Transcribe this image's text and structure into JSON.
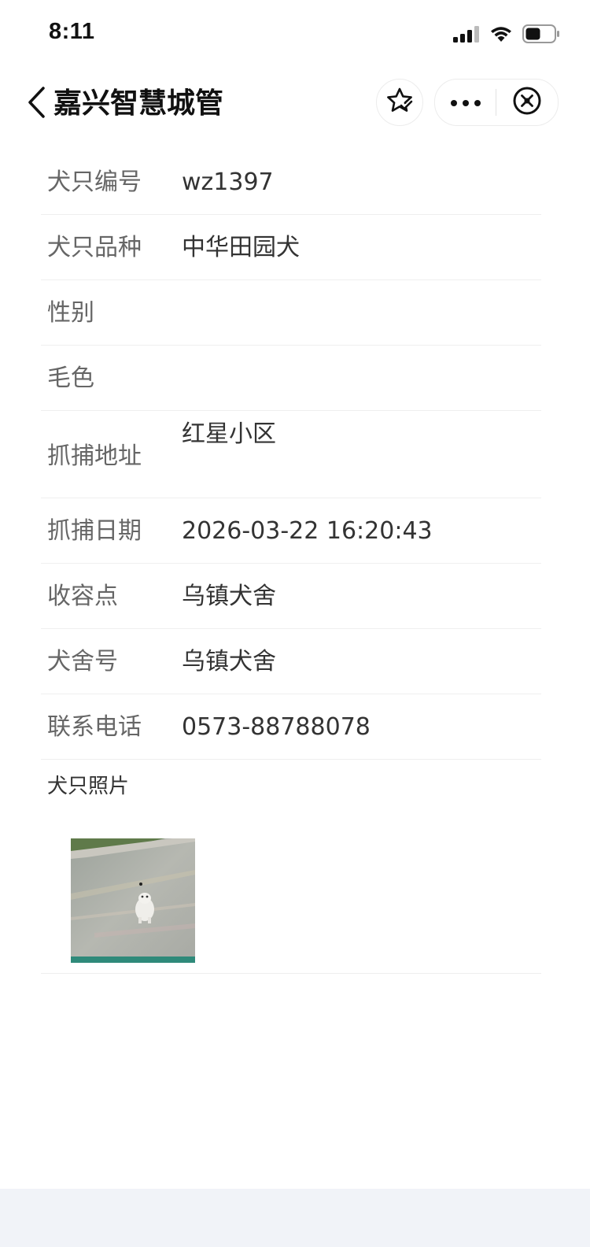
{
  "status_bar": {
    "time": "8:11",
    "icons": [
      "cellular-signal-icon",
      "wifi-icon",
      "battery-icon"
    ]
  },
  "nav": {
    "back_icon": "chevron-left-icon",
    "title": "嘉兴智慧城管",
    "favorite_icon": "star-icon",
    "more_icon": "more-dots-icon",
    "close_icon": "close-circle-icon"
  },
  "info": {
    "dog_id": {
      "label": "犬只编号",
      "value": "wz1397"
    },
    "breed": {
      "label": "犬只品种",
      "value": "中华田园犬"
    },
    "gender": {
      "label": "性别",
      "value": ""
    },
    "coat_color": {
      "label": "毛色",
      "value": ""
    },
    "capture_address": {
      "label": "抓捕地址",
      "value": "红星小区"
    },
    "capture_date": {
      "label": "抓捕日期",
      "value": "2026-03-22 16:20:43"
    },
    "shelter": {
      "label": "收容点",
      "value": "乌镇犬舍"
    },
    "kennel_no": {
      "label": "犬舍号",
      "value": "乌镇犬舍"
    },
    "phone": {
      "label": "联系电话",
      "value": "0573-88788078"
    }
  },
  "photo": {
    "label": "犬只照片"
  },
  "colors": {
    "label": "#666666",
    "value": "#333333",
    "divider": "#efefef",
    "bottom_band": "#f1f3f8"
  }
}
